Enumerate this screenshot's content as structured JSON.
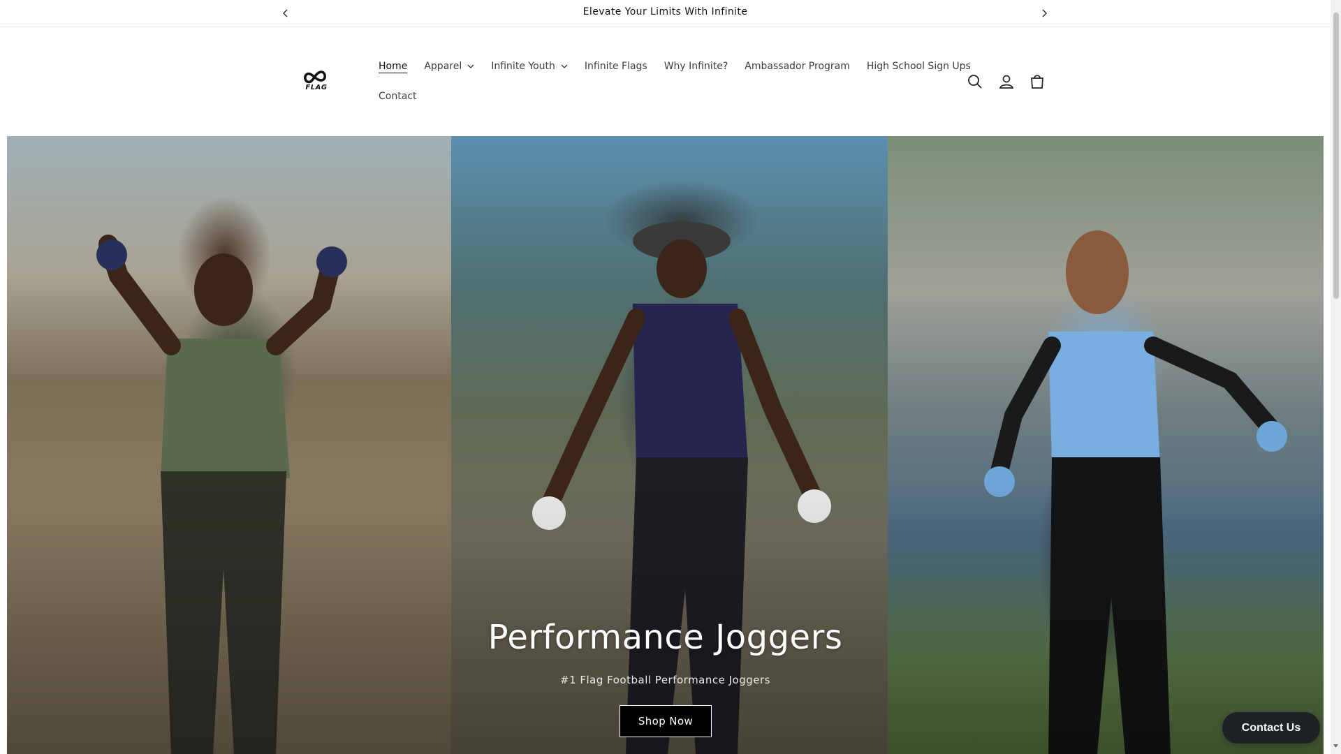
{
  "announcement": {
    "text": "Elevate Your Limits With Infinite",
    "prev_icon": "chevron-left-icon",
    "next_icon": "chevron-right-icon"
  },
  "header": {
    "logo_text": "FLAG",
    "nav": [
      {
        "label": "Home",
        "active": true,
        "dropdown": false
      },
      {
        "label": "Apparel",
        "active": false,
        "dropdown": true
      },
      {
        "label": "Infinite Youth",
        "active": false,
        "dropdown": true
      },
      {
        "label": "Infinite Flags",
        "active": false,
        "dropdown": false
      },
      {
        "label": "Why Infinite?",
        "active": false,
        "dropdown": false
      },
      {
        "label": "Ambassador Program",
        "active": false,
        "dropdown": false
      },
      {
        "label": "High School Sign Ups",
        "active": false,
        "dropdown": false
      },
      {
        "label": "Contact",
        "active": false,
        "dropdown": false
      }
    ],
    "icons": [
      "search-icon",
      "account-icon",
      "cart-icon"
    ]
  },
  "hero": {
    "title": "Performance Joggers",
    "subtitle": "#1 Flag Football Performance Joggers",
    "button_label": "Shop Now"
  },
  "chat": {
    "label": "Contact Us"
  },
  "colors": {
    "text": "#121212",
    "nav_text": "#3d3d3d",
    "button_bg": "#000000",
    "chat_bg": "#202326"
  }
}
